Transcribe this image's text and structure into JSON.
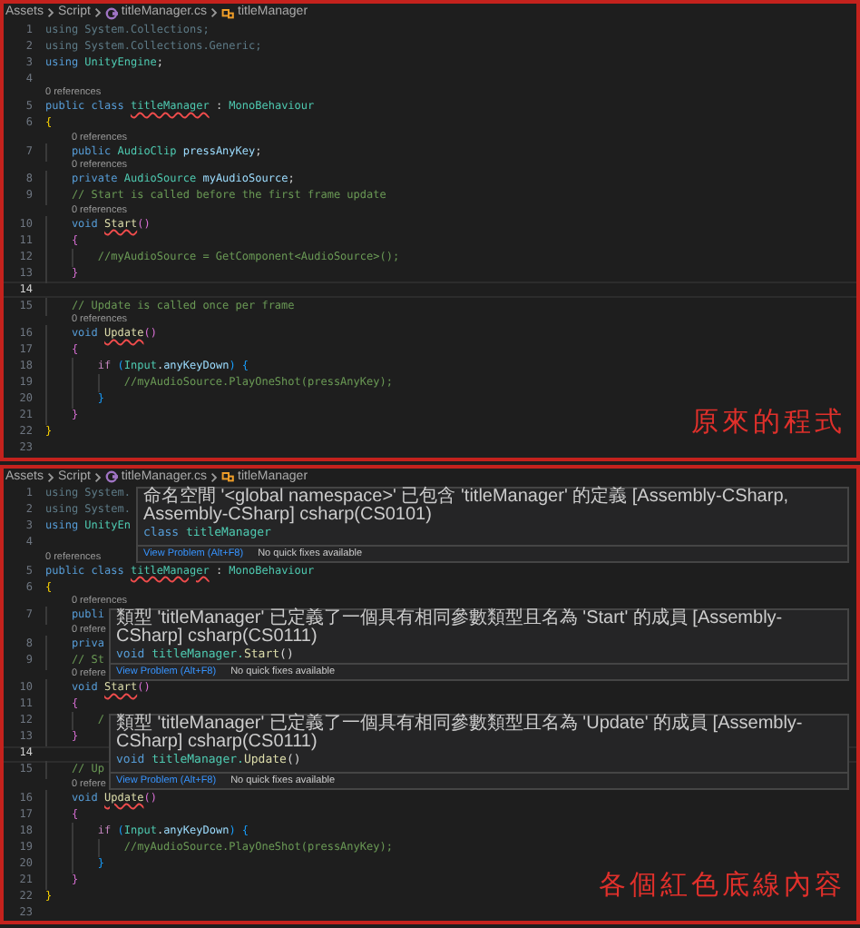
{
  "panels": [
    {
      "breadcrumb": {
        "folders": [
          "Assets",
          "Script"
        ],
        "file": "titleManager.cs",
        "symbol": "titleManager"
      },
      "lines": [
        {
          "kind": "code",
          "number": "1",
          "current": false,
          "tokens": [
            {
              "text": "using System.Collections;",
              "kind": "dim",
              "error": false
            }
          ]
        },
        {
          "kind": "code",
          "number": "2",
          "current": false,
          "tokens": [
            {
              "text": "using System.Collections.Generic;",
              "kind": "dim",
              "error": false
            }
          ]
        },
        {
          "kind": "code",
          "number": "3",
          "current": false,
          "tokens": [
            {
              "text": "using",
              "kind": "kw",
              "error": false
            },
            {
              "text": " UnityEngine",
              "kind": "type",
              "error": false
            },
            {
              "text": ";",
              "kind": "p",
              "error": false
            }
          ]
        },
        {
          "kind": "code",
          "number": "4",
          "current": false
        },
        {
          "kind": "codelens",
          "text": "0 references"
        },
        {
          "kind": "code",
          "number": "5",
          "current": false,
          "tokens": [
            {
              "text": "public class ",
              "kind": "kw",
              "error": false
            },
            {
              "text": "titleManager",
              "kind": "type",
              "error": true
            },
            {
              "text": " : ",
              "kind": "p",
              "error": false
            },
            {
              "text": "MonoBehaviour",
              "kind": "type",
              "error": false
            }
          ]
        },
        {
          "kind": "code",
          "number": "6",
          "current": false,
          "tokens": [
            {
              "text": "{",
              "kind": "b1",
              "error": false
            }
          ]
        },
        {
          "kind": "codelens",
          "text": "0 references"
        },
        {
          "kind": "code",
          "number": "7",
          "current": false,
          "tokens": [
            {
              "text": "    public ",
              "kind": "kw",
              "error": false
            },
            {
              "text": "AudioClip",
              "kind": "type",
              "error": false
            },
            {
              "text": " pressAnyKey",
              "kind": "var",
              "error": false
            },
            {
              "text": ";",
              "kind": "p",
              "error": false
            }
          ]
        },
        {
          "kind": "codelens",
          "text": "0 references"
        },
        {
          "kind": "code",
          "number": "8",
          "current": false,
          "tokens": [
            {
              "text": "    private ",
              "kind": "kw",
              "error": false
            },
            {
              "text": "AudioSource",
              "kind": "type",
              "error": false
            },
            {
              "text": " myAudioSource",
              "kind": "var",
              "error": false
            },
            {
              "text": ";",
              "kind": "p",
              "error": false
            }
          ]
        },
        {
          "kind": "code",
          "number": "9",
          "current": false,
          "tokens": [
            {
              "text": "    // Start is called before the first frame update",
              "kind": "cmt",
              "error": false
            }
          ]
        },
        {
          "kind": "codelens",
          "text": "0 references"
        },
        {
          "kind": "code",
          "number": "10",
          "current": false,
          "tokens": [
            {
              "text": "    void ",
              "kind": "kw",
              "error": false
            },
            {
              "text": "Start",
              "kind": "fn",
              "error": true
            },
            {
              "text": "()",
              "kind": "b2",
              "error": false
            }
          ]
        },
        {
          "kind": "code",
          "number": "11",
          "current": false,
          "tokens": [
            {
              "text": "    {",
              "kind": "b2",
              "error": false
            }
          ]
        },
        {
          "kind": "code",
          "number": "12",
          "current": false,
          "tokens": [
            {
              "text": "        //myAudioSource = GetComponent<AudioSource>();",
              "kind": "cmt",
              "error": false
            }
          ]
        },
        {
          "kind": "code",
          "number": "13",
          "current": false,
          "tokens": [
            {
              "text": "    }",
              "kind": "b2",
              "error": false
            }
          ]
        },
        {
          "kind": "code",
          "number": "14",
          "current": true
        },
        {
          "kind": "code",
          "number": "15",
          "current": false,
          "tokens": [
            {
              "text": "    // Update is called once per frame",
              "kind": "cmt",
              "error": false
            }
          ]
        },
        {
          "kind": "codelens",
          "text": "0 references"
        },
        {
          "kind": "code",
          "number": "16",
          "current": false,
          "tokens": [
            {
              "text": "    void ",
              "kind": "kw",
              "error": false
            },
            {
              "text": "Update",
              "kind": "fn",
              "error": true
            },
            {
              "text": "()",
              "kind": "b2",
              "error": false
            }
          ]
        },
        {
          "kind": "code",
          "number": "17",
          "current": false,
          "tokens": [
            {
              "text": "    {",
              "kind": "b2",
              "error": false
            }
          ]
        },
        {
          "kind": "code",
          "number": "18",
          "current": false,
          "tokens": [
            {
              "text": "        if ",
              "kind": "ctl",
              "error": false
            },
            {
              "text": "(",
              "kind": "b3",
              "error": false
            },
            {
              "text": "Input",
              "kind": "type",
              "error": false
            },
            {
              "text": ".",
              "kind": "p",
              "error": false
            },
            {
              "text": "anyKeyDown",
              "kind": "var",
              "error": false
            },
            {
              "text": ") {",
              "kind": "b3",
              "error": false
            }
          ]
        },
        {
          "kind": "code",
          "number": "19",
          "current": false,
          "tokens": [
            {
              "text": "            //myAudioSource.PlayOneShot(pressAnyKey);",
              "kind": "cmt",
              "error": false
            }
          ]
        },
        {
          "kind": "code",
          "number": "20",
          "current": false,
          "tokens": [
            {
              "text": "        }",
              "kind": "b3",
              "error": false
            }
          ]
        },
        {
          "kind": "code",
          "number": "21",
          "current": false,
          "tokens": [
            {
              "text": "    }",
              "kind": "b2",
              "error": false
            }
          ]
        },
        {
          "kind": "code",
          "number": "22",
          "current": false,
          "tokens": [
            {
              "text": "}",
              "kind": "b1",
              "error": false
            }
          ]
        },
        {
          "kind": "code",
          "number": "23",
          "current": false
        }
      ],
      "annotation": "原來的程式"
    },
    {
      "breadcrumb": {
        "folders": [
          "Assets",
          "Script"
        ],
        "file": "titleManager.cs",
        "symbol": "titleManager"
      },
      "lines": [
        {
          "kind": "code",
          "number": "1",
          "current": false,
          "tokens": [
            {
              "text": "using System.",
              "kind": "dim",
              "error": false
            }
          ]
        },
        {
          "kind": "code",
          "number": "2",
          "current": false,
          "tokens": [
            {
              "text": "using System.",
              "kind": "dim",
              "error": false
            }
          ]
        },
        {
          "kind": "code",
          "number": "3",
          "current": false,
          "tokens": [
            {
              "text": "using",
              "kind": "kw",
              "error": false
            },
            {
              "text": " UnityEn",
              "kind": "type",
              "error": false
            }
          ]
        },
        {
          "kind": "code",
          "number": "4",
          "current": false
        },
        {
          "kind": "codelens",
          "text": "0 references"
        },
        {
          "kind": "code",
          "number": "5",
          "current": false,
          "tokens": [
            {
              "text": "public class ",
              "kind": "kw",
              "error": false
            },
            {
              "text": "titleManager",
              "kind": "type",
              "error": true
            },
            {
              "text": " : ",
              "kind": "p",
              "error": false
            },
            {
              "text": "MonoBehaviour",
              "kind": "type",
              "error": false
            }
          ]
        },
        {
          "kind": "code",
          "number": "6",
          "current": false,
          "tokens": [
            {
              "text": "{",
              "kind": "b1",
              "error": false
            }
          ]
        },
        {
          "kind": "codelens",
          "text": "0 references"
        },
        {
          "kind": "code",
          "number": "7",
          "current": false,
          "tokens": [
            {
              "text": "    publi",
              "kind": "kw",
              "error": false
            }
          ]
        },
        {
          "kind": "codelens",
          "text": "0 refere"
        },
        {
          "kind": "code",
          "number": "8",
          "current": false,
          "tokens": [
            {
              "text": "    priva",
              "kind": "kw",
              "error": false
            }
          ]
        },
        {
          "kind": "code",
          "number": "9",
          "current": false,
          "tokens": [
            {
              "text": "    // St",
              "kind": "cmt",
              "error": false
            }
          ]
        },
        {
          "kind": "codelens",
          "text": "0 refere"
        },
        {
          "kind": "code",
          "number": "10",
          "current": false,
          "tokens": [
            {
              "text": "    void ",
              "kind": "kw",
              "error": false
            },
            {
              "text": "Start",
              "kind": "fn",
              "error": true
            },
            {
              "text": "()",
              "kind": "b2",
              "error": false
            }
          ]
        },
        {
          "kind": "code",
          "number": "11",
          "current": false,
          "tokens": [
            {
              "text": "    {",
              "kind": "b2",
              "error": false
            }
          ]
        },
        {
          "kind": "code",
          "number": "12",
          "current": false,
          "tokens": [
            {
              "text": "        /",
              "kind": "cmt",
              "error": false
            }
          ]
        },
        {
          "kind": "code",
          "number": "13",
          "current": false,
          "tokens": [
            {
              "text": "    }",
              "kind": "b2",
              "error": false
            }
          ]
        },
        {
          "kind": "code",
          "number": "14",
          "current": true
        },
        {
          "kind": "code",
          "number": "15",
          "current": false,
          "tokens": [
            {
              "text": "    // Up",
              "kind": "cmt",
              "error": false
            }
          ]
        },
        {
          "kind": "codelens",
          "text": "0 refere"
        },
        {
          "kind": "code",
          "number": "16",
          "current": false,
          "tokens": [
            {
              "text": "    void ",
              "kind": "kw",
              "error": false
            },
            {
              "text": "Update",
              "kind": "fn",
              "error": true
            },
            {
              "text": "()",
              "kind": "b2",
              "error": false
            }
          ]
        },
        {
          "kind": "code",
          "number": "17",
          "current": false,
          "tokens": [
            {
              "text": "    {",
              "kind": "b2",
              "error": false
            }
          ]
        },
        {
          "kind": "code",
          "number": "18",
          "current": false,
          "tokens": [
            {
              "text": "        if ",
              "kind": "ctl",
              "error": false
            },
            {
              "text": "(",
              "kind": "b3",
              "error": false
            },
            {
              "text": "Input",
              "kind": "type",
              "error": false
            },
            {
              "text": ".",
              "kind": "p",
              "error": false
            },
            {
              "text": "anyKeyDown",
              "kind": "var",
              "error": false
            },
            {
              "text": ") {",
              "kind": "b3",
              "error": false
            }
          ]
        },
        {
          "kind": "code",
          "number": "19",
          "current": false,
          "tokens": [
            {
              "text": "            //myAudioSource.PlayOneShot(pressAnyKey);",
              "kind": "cmt",
              "error": false
            }
          ]
        },
        {
          "kind": "code",
          "number": "20",
          "current": false,
          "tokens": [
            {
              "text": "        }",
              "kind": "b3",
              "error": false
            }
          ]
        },
        {
          "kind": "code",
          "number": "21",
          "current": false,
          "tokens": [
            {
              "text": "    }",
              "kind": "b2",
              "error": false
            }
          ]
        },
        {
          "kind": "code",
          "number": "22",
          "current": false,
          "tokens": [
            {
              "text": "}",
              "kind": "b1",
              "error": false
            }
          ]
        },
        {
          "kind": "code",
          "number": "23",
          "current": false
        }
      ],
      "hovers": [
        {
          "message": "命名空間 '<global namespace>' 已包含 'titleManager' 的定義 [Assembly-CSharp, Assembly-CSharp] csharp(CS0101)",
          "signature": [
            {
              "text": "class ",
              "kind": "kw"
            },
            {
              "text": "titleManager",
              "kind": "type"
            }
          ],
          "link": "View Problem (Alt+F8)",
          "note": "No quick fixes available"
        },
        {
          "message": "類型 'titleManager' 已定義了一個具有相同參數類型且名為 'Start' 的成員 [Assembly-CSharp] csharp(CS0111)",
          "signature": [
            {
              "text": "void ",
              "kind": "kw"
            },
            {
              "text": "titleManager.",
              "kind": "type"
            },
            {
              "text": "Start",
              "kind": "fn"
            },
            {
              "text": "()",
              "kind": "p"
            }
          ],
          "link": "View Problem (Alt+F8)",
          "note": "No quick fixes available"
        },
        {
          "message": "類型 'titleManager' 已定義了一個具有相同參數類型且名為 'Update' 的成員 [Assembly-CSharp] csharp(CS0111)",
          "signature": [
            {
              "text": "void ",
              "kind": "kw"
            },
            {
              "text": "titleManager.",
              "kind": "type"
            },
            {
              "text": "Update",
              "kind": "fn"
            },
            {
              "text": "()",
              "kind": "p"
            }
          ],
          "link": "View Problem (Alt+F8)",
          "note": "No quick fixes available"
        }
      ],
      "annotation": "各個紅色底線內容"
    }
  ]
}
